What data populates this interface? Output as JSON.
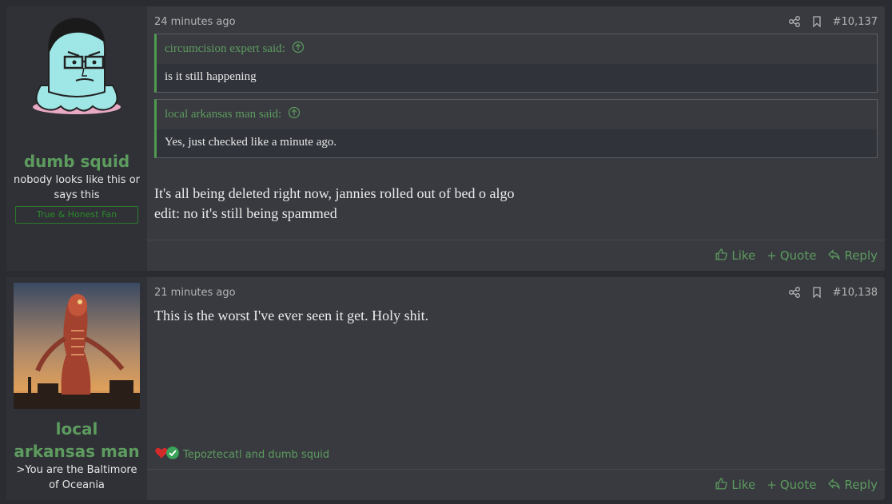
{
  "posts": [
    {
      "user": {
        "name": "dumb squid",
        "title": "nobody looks like this or says this",
        "banner": "True & Honest Fan"
      },
      "time": "24 minutes ago",
      "number": "#10,137",
      "quotes": [
        {
          "author": "circumcision expert said:",
          "text": "is it still happening"
        },
        {
          "author": "local arkansas man said:",
          "text": "Yes, just checked like a minute ago."
        }
      ],
      "body_lines": [
        "It's all being deleted right now, jannies rolled out of bed o algo",
        "edit: no it's still being spammed"
      ],
      "actions": {
        "like": "Like",
        "quote": "Quote",
        "reply": "Reply"
      }
    },
    {
      "user": {
        "name": "local arkansas man",
        "title": ">You are the Baltimore of Oceania"
      },
      "time": "21 minutes ago",
      "number": "#10,138",
      "body_lines": [
        "This is the worst I've ever seen it get. Holy shit."
      ],
      "reactions_text": "Tepoztecatl and dumb squid",
      "actions": {
        "like": "Like",
        "quote": "Quote",
        "reply": "Reply"
      }
    }
  ],
  "colors": {
    "accent": "#5d9b5e",
    "background": "#2a2c31",
    "post": "#383a40",
    "sidebar": "#2f3136"
  }
}
